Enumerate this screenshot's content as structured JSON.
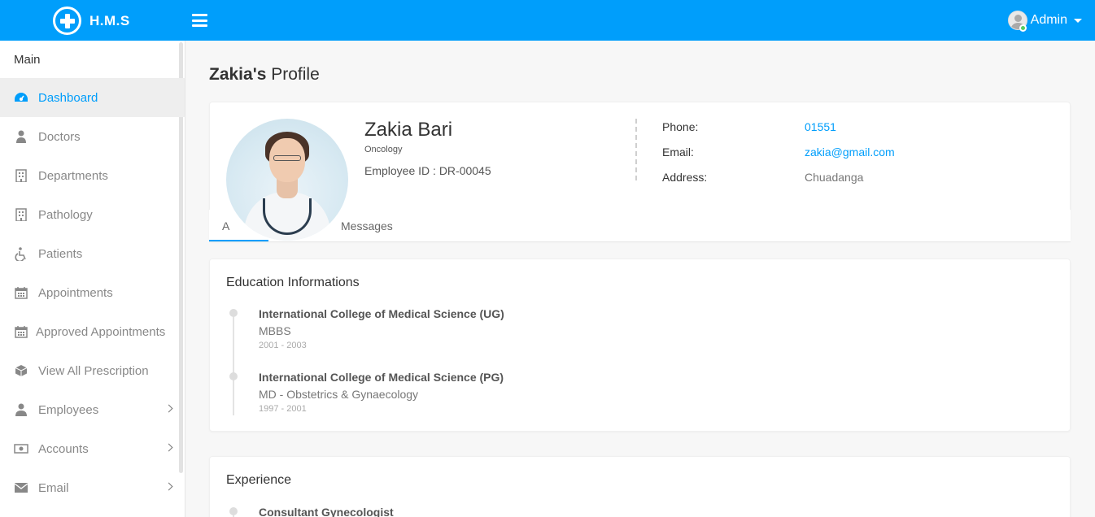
{
  "header": {
    "brand": "H.M.S",
    "user_label": "Admin",
    "accent_color": "#009efb"
  },
  "sidebar": {
    "section_title": "Main",
    "items": [
      {
        "label": "Dashboard",
        "icon": "dashboard-icon",
        "active": true
      },
      {
        "label": "Doctors",
        "icon": "doctor-icon"
      },
      {
        "label": "Departments",
        "icon": "hospital-icon"
      },
      {
        "label": "Pathology",
        "icon": "hospital-icon"
      },
      {
        "label": "Patients",
        "icon": "wheelchair-icon"
      },
      {
        "label": "Appointments",
        "icon": "calendar-icon"
      },
      {
        "label": "Approved Appointments",
        "icon": "calendar-icon"
      },
      {
        "label": "View All Prescription",
        "icon": "cube-icon"
      },
      {
        "label": "Employees",
        "icon": "user-icon",
        "submenu": true
      },
      {
        "label": "Accounts",
        "icon": "money-icon",
        "submenu": true
      },
      {
        "label": "Email",
        "icon": "envelope-icon",
        "submenu": true
      }
    ]
  },
  "page": {
    "title_bold": "Zakia's",
    "title_rest": "Profile"
  },
  "profile": {
    "name": "Zakia Bari",
    "department": "Oncology",
    "employee_id": "Employee ID : DR-00045",
    "phone_label": "Phone:",
    "phone": "01551",
    "email_label": "Email:",
    "email": "zakia@gmail.com",
    "address_label": "Address:",
    "address": "Chuadanga"
  },
  "tabs": {
    "first_visible": "A",
    "messages": "Messages"
  },
  "education": {
    "title": "Education Informations",
    "items": [
      {
        "school": "International College of Medical Science (UG)",
        "degree": "MBBS",
        "years": "2001 - 2003"
      },
      {
        "school": "International College of Medical Science (PG)",
        "degree": "MD - Obstetrics & Gynaecology",
        "years": "1997 - 2001"
      }
    ]
  },
  "experience": {
    "title": "Experience",
    "items": [
      {
        "role": "Consultant Gynecologist"
      }
    ]
  }
}
